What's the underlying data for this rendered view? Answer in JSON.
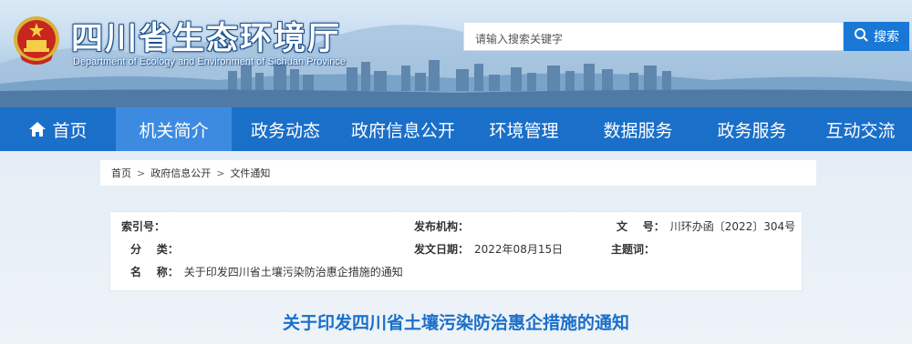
{
  "header": {
    "title": "四川省生态环境厅",
    "subtitle": "Department of Ecology and Environment of Sichuan Province",
    "search_placeholder": "请输入搜索关键字",
    "search_button": "搜索"
  },
  "nav": {
    "items": [
      {
        "label": "首页"
      },
      {
        "label": "机关简介"
      },
      {
        "label": "政务动态"
      },
      {
        "label": "政府信息公开"
      },
      {
        "label": "环境管理"
      },
      {
        "label": "数据服务"
      },
      {
        "label": "政务服务"
      },
      {
        "label": "互动交流"
      }
    ],
    "active": "机关简介"
  },
  "breadcrumb": {
    "items": [
      "首页",
      "政府信息公开",
      "文件通知"
    ],
    "separator": ">"
  },
  "meta": {
    "index_label": "索引号：",
    "index_value": "",
    "publisher_label": "发布机构：",
    "publisher_value": "",
    "doc_no_label": "文    号：",
    "doc_no_value": "川环办函〔2022〕304号",
    "category_label": "分    类：",
    "category_value": "",
    "date_label": "发文日期：",
    "date_value": "2022年08月15日",
    "topic_label": "主题词：",
    "topic_value": "",
    "name_label": "名    称：",
    "name_value": "关于印发四川省土壤污染防治惠企措施的通知"
  },
  "article": {
    "title": "关于印发四川省土壤污染防治惠企措施的通知"
  },
  "colors": {
    "nav_bg": "#1a6fc9",
    "nav_active": "#3d8be0",
    "search_button": "#1978d6",
    "title_blue": "#1a6fc9"
  }
}
